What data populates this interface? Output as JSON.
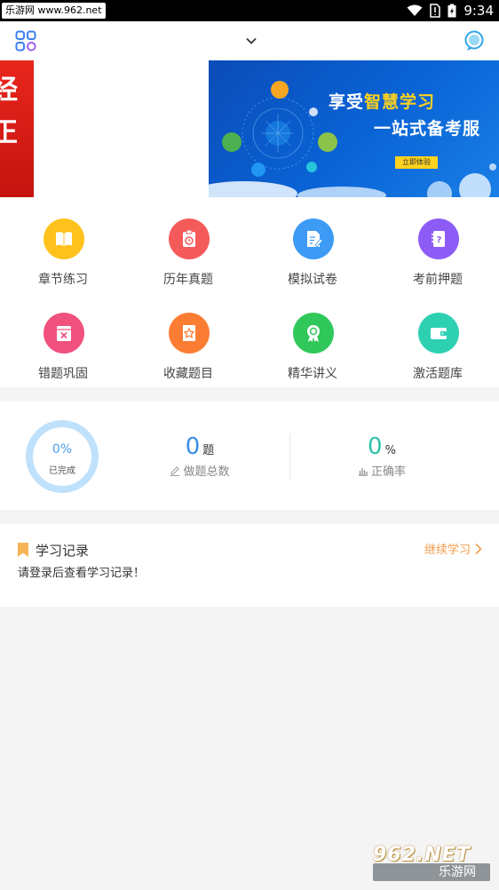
{
  "status_bar": {
    "watermark_badge": "乐游网 www.962.net",
    "time": "9:34"
  },
  "header": {
    "menu_icon": "grid-apps-icon",
    "dropdown_icon": "chevron-down-icon",
    "chat_icon": "chat-bubble-icon"
  },
  "banner": {
    "left_partial_chars": [
      "经",
      "正"
    ],
    "title_prefix": "享受",
    "title_highlight": "智慧学习",
    "subtitle": "一站式备考服",
    "button_label": "立即体验"
  },
  "features": [
    {
      "label": "章节练习",
      "icon": "book-icon",
      "color": "#ffc21d"
    },
    {
      "label": "历年真题",
      "icon": "clipboard-clock-icon",
      "color": "#f55a5a"
    },
    {
      "label": "模拟试卷",
      "icon": "document-edit-icon",
      "color": "#3d9bf5"
    },
    {
      "label": "考前押题",
      "icon": "notebook-question-icon",
      "color": "#8d5cf6"
    },
    {
      "label": "错题巩固",
      "icon": "error-book-icon",
      "color": "#f0517e"
    },
    {
      "label": "收藏题目",
      "icon": "star-note-icon",
      "color": "#fb7d34"
    },
    {
      "label": "精华讲义",
      "icon": "award-medal-icon",
      "color": "#30c85a"
    },
    {
      "label": "激活题库",
      "icon": "wallet-icon",
      "color": "#2ed0b2"
    }
  ],
  "stats": {
    "completion_percent": "0%",
    "completion_label": "已完成",
    "questions_done": "0",
    "questions_unit": "题",
    "questions_label": "做题总数",
    "accuracy": "0",
    "accuracy_unit": "%",
    "accuracy_label": "正确率"
  },
  "record": {
    "title": "学习记录",
    "continue_label": "继续学习",
    "message": "请登录后查看学习记录！"
  },
  "watermark": {
    "logo": "962.NET",
    "text": "乐游网"
  }
}
